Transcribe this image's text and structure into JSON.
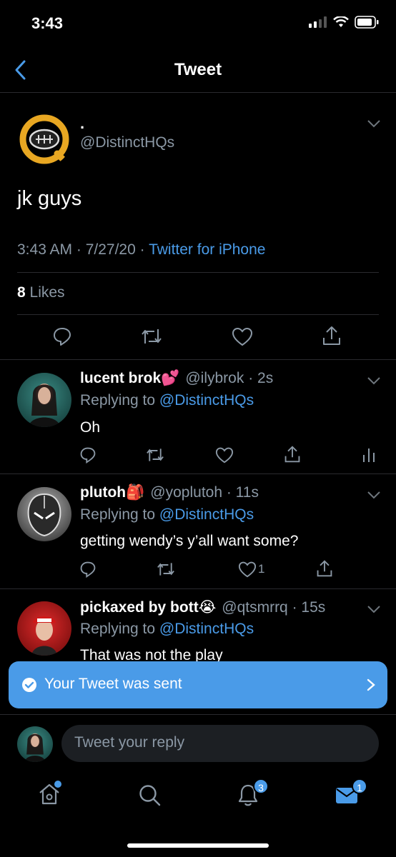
{
  "status_bar": {
    "time": "3:43"
  },
  "nav": {
    "title": "Tweet"
  },
  "tweet": {
    "display_name": ".",
    "handle": "@DistinctHQs",
    "text": "jk guys",
    "time": "3:43 AM · 7/27/20 · ",
    "source": "Twitter for iPhone",
    "likes_count": "8",
    "likes_label": " Likes"
  },
  "replies": [
    {
      "name": "lucent brok",
      "emoji": "💕",
      "handle": "@ilybrok",
      "age": " · 2s",
      "replying_prefix": "Replying to ",
      "replying_to": "@DistinctHQs",
      "text": "Oh",
      "like_count": ""
    },
    {
      "name": "plutoh",
      "emoji": "🎒",
      "handle": "@yoplutoh",
      "age": " · 11s",
      "replying_prefix": "Replying to ",
      "replying_to": "@DistinctHQs",
      "text": "getting wendy’s y’all want some?",
      "like_count": "1"
    },
    {
      "name": "pickaxed by bott",
      "emoji": "😭",
      "handle": "@qtsmrrq",
      "age": " · 15s",
      "replying_prefix": "Replying to ",
      "replying_to": "@DistinctHQs",
      "text": "That was not the play"
    }
  ],
  "toast": {
    "text": "Your Tweet was sent"
  },
  "reply_input": {
    "placeholder": "Tweet your reply"
  },
  "tab_bar": {
    "notifications_badge": "3",
    "messages_badge": "1"
  },
  "colors": {
    "accent": "#4a9be8",
    "link": "#1d9bf0",
    "muted": "#8b98a5",
    "background": "#000000"
  }
}
